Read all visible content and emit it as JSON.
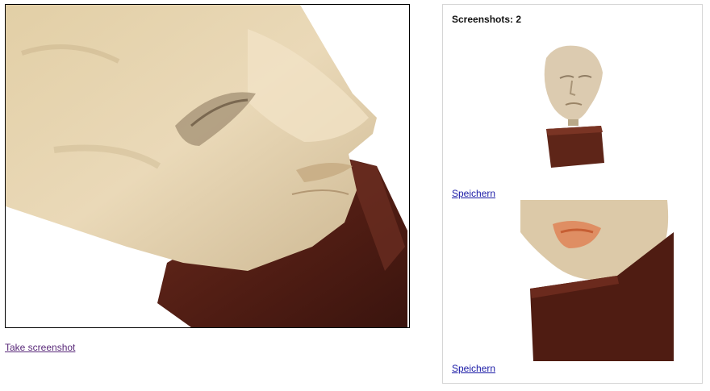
{
  "viewer": {
    "subject": "3d-model-head-sculpture-on-wooden-block",
    "take_screenshot_label": "Take screenshot"
  },
  "screenshots_panel": {
    "title": "Screenshots: 2",
    "items": [
      {
        "save_label": "Speichern"
      },
      {
        "save_label": "Speichern"
      }
    ]
  },
  "colors": {
    "skin": "#e8d5b0",
    "wood": "#5a2117",
    "link": "#1a1aa6",
    "visited_link": "#5a2a7a"
  }
}
